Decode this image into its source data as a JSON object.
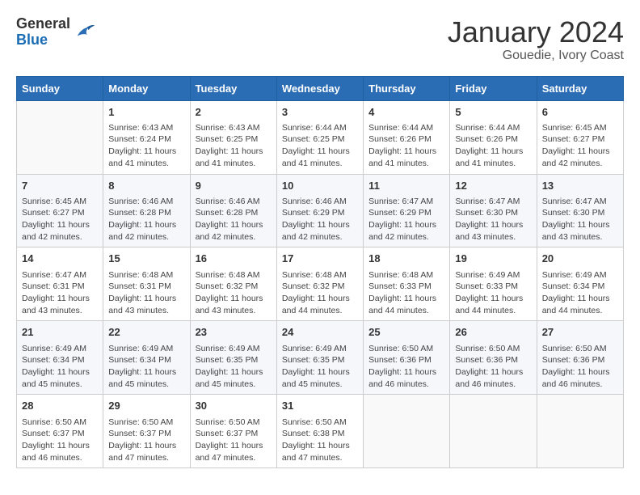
{
  "header": {
    "logo_general": "General",
    "logo_blue": "Blue",
    "title": "January 2024",
    "subtitle": "Gouedie, Ivory Coast"
  },
  "days_of_week": [
    "Sunday",
    "Monday",
    "Tuesday",
    "Wednesday",
    "Thursday",
    "Friday",
    "Saturday"
  ],
  "weeks": [
    [
      {
        "day": "",
        "sunrise": "",
        "sunset": "",
        "daylight": ""
      },
      {
        "day": "1",
        "sunrise": "Sunrise: 6:43 AM",
        "sunset": "Sunset: 6:24 PM",
        "daylight": "Daylight: 11 hours and 41 minutes."
      },
      {
        "day": "2",
        "sunrise": "Sunrise: 6:43 AM",
        "sunset": "Sunset: 6:25 PM",
        "daylight": "Daylight: 11 hours and 41 minutes."
      },
      {
        "day": "3",
        "sunrise": "Sunrise: 6:44 AM",
        "sunset": "Sunset: 6:25 PM",
        "daylight": "Daylight: 11 hours and 41 minutes."
      },
      {
        "day": "4",
        "sunrise": "Sunrise: 6:44 AM",
        "sunset": "Sunset: 6:26 PM",
        "daylight": "Daylight: 11 hours and 41 minutes."
      },
      {
        "day": "5",
        "sunrise": "Sunrise: 6:44 AM",
        "sunset": "Sunset: 6:26 PM",
        "daylight": "Daylight: 11 hours and 41 minutes."
      },
      {
        "day": "6",
        "sunrise": "Sunrise: 6:45 AM",
        "sunset": "Sunset: 6:27 PM",
        "daylight": "Daylight: 11 hours and 42 minutes."
      }
    ],
    [
      {
        "day": "7",
        "sunrise": "Sunrise: 6:45 AM",
        "sunset": "Sunset: 6:27 PM",
        "daylight": "Daylight: 11 hours and 42 minutes."
      },
      {
        "day": "8",
        "sunrise": "Sunrise: 6:46 AM",
        "sunset": "Sunset: 6:28 PM",
        "daylight": "Daylight: 11 hours and 42 minutes."
      },
      {
        "day": "9",
        "sunrise": "Sunrise: 6:46 AM",
        "sunset": "Sunset: 6:28 PM",
        "daylight": "Daylight: 11 hours and 42 minutes."
      },
      {
        "day": "10",
        "sunrise": "Sunrise: 6:46 AM",
        "sunset": "Sunset: 6:29 PM",
        "daylight": "Daylight: 11 hours and 42 minutes."
      },
      {
        "day": "11",
        "sunrise": "Sunrise: 6:47 AM",
        "sunset": "Sunset: 6:29 PM",
        "daylight": "Daylight: 11 hours and 42 minutes."
      },
      {
        "day": "12",
        "sunrise": "Sunrise: 6:47 AM",
        "sunset": "Sunset: 6:30 PM",
        "daylight": "Daylight: 11 hours and 43 minutes."
      },
      {
        "day": "13",
        "sunrise": "Sunrise: 6:47 AM",
        "sunset": "Sunset: 6:30 PM",
        "daylight": "Daylight: 11 hours and 43 minutes."
      }
    ],
    [
      {
        "day": "14",
        "sunrise": "Sunrise: 6:47 AM",
        "sunset": "Sunset: 6:31 PM",
        "daylight": "Daylight: 11 hours and 43 minutes."
      },
      {
        "day": "15",
        "sunrise": "Sunrise: 6:48 AM",
        "sunset": "Sunset: 6:31 PM",
        "daylight": "Daylight: 11 hours and 43 minutes."
      },
      {
        "day": "16",
        "sunrise": "Sunrise: 6:48 AM",
        "sunset": "Sunset: 6:32 PM",
        "daylight": "Daylight: 11 hours and 43 minutes."
      },
      {
        "day": "17",
        "sunrise": "Sunrise: 6:48 AM",
        "sunset": "Sunset: 6:32 PM",
        "daylight": "Daylight: 11 hours and 44 minutes."
      },
      {
        "day": "18",
        "sunrise": "Sunrise: 6:48 AM",
        "sunset": "Sunset: 6:33 PM",
        "daylight": "Daylight: 11 hours and 44 minutes."
      },
      {
        "day": "19",
        "sunrise": "Sunrise: 6:49 AM",
        "sunset": "Sunset: 6:33 PM",
        "daylight": "Daylight: 11 hours and 44 minutes."
      },
      {
        "day": "20",
        "sunrise": "Sunrise: 6:49 AM",
        "sunset": "Sunset: 6:34 PM",
        "daylight": "Daylight: 11 hours and 44 minutes."
      }
    ],
    [
      {
        "day": "21",
        "sunrise": "Sunrise: 6:49 AM",
        "sunset": "Sunset: 6:34 PM",
        "daylight": "Daylight: 11 hours and 45 minutes."
      },
      {
        "day": "22",
        "sunrise": "Sunrise: 6:49 AM",
        "sunset": "Sunset: 6:34 PM",
        "daylight": "Daylight: 11 hours and 45 minutes."
      },
      {
        "day": "23",
        "sunrise": "Sunrise: 6:49 AM",
        "sunset": "Sunset: 6:35 PM",
        "daylight": "Daylight: 11 hours and 45 minutes."
      },
      {
        "day": "24",
        "sunrise": "Sunrise: 6:49 AM",
        "sunset": "Sunset: 6:35 PM",
        "daylight": "Daylight: 11 hours and 45 minutes."
      },
      {
        "day": "25",
        "sunrise": "Sunrise: 6:50 AM",
        "sunset": "Sunset: 6:36 PM",
        "daylight": "Daylight: 11 hours and 46 minutes."
      },
      {
        "day": "26",
        "sunrise": "Sunrise: 6:50 AM",
        "sunset": "Sunset: 6:36 PM",
        "daylight": "Daylight: 11 hours and 46 minutes."
      },
      {
        "day": "27",
        "sunrise": "Sunrise: 6:50 AM",
        "sunset": "Sunset: 6:36 PM",
        "daylight": "Daylight: 11 hours and 46 minutes."
      }
    ],
    [
      {
        "day": "28",
        "sunrise": "Sunrise: 6:50 AM",
        "sunset": "Sunset: 6:37 PM",
        "daylight": "Daylight: 11 hours and 46 minutes."
      },
      {
        "day": "29",
        "sunrise": "Sunrise: 6:50 AM",
        "sunset": "Sunset: 6:37 PM",
        "daylight": "Daylight: 11 hours and 47 minutes."
      },
      {
        "day": "30",
        "sunrise": "Sunrise: 6:50 AM",
        "sunset": "Sunset: 6:37 PM",
        "daylight": "Daylight: 11 hours and 47 minutes."
      },
      {
        "day": "31",
        "sunrise": "Sunrise: 6:50 AM",
        "sunset": "Sunset: 6:38 PM",
        "daylight": "Daylight: 11 hours and 47 minutes."
      },
      {
        "day": "",
        "sunrise": "",
        "sunset": "",
        "daylight": ""
      },
      {
        "day": "",
        "sunrise": "",
        "sunset": "",
        "daylight": ""
      },
      {
        "day": "",
        "sunrise": "",
        "sunset": "",
        "daylight": ""
      }
    ]
  ]
}
